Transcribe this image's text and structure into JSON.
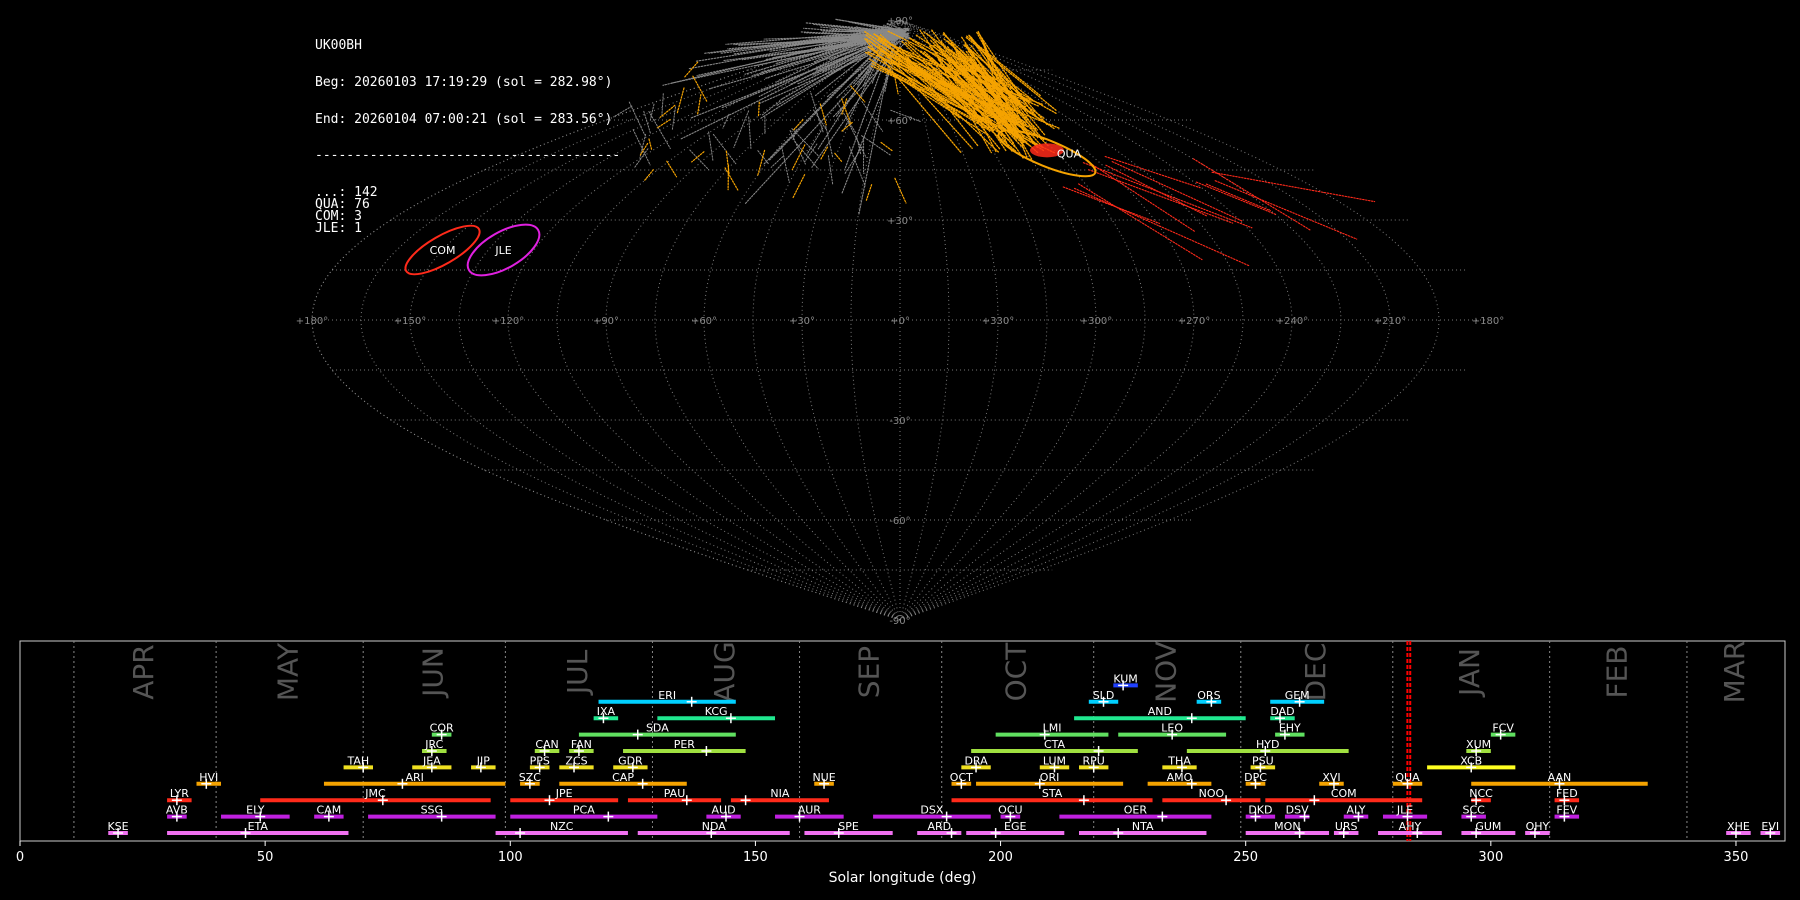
{
  "info": {
    "station": "UK00BH",
    "begin": "Beg: 20260103 17:19:29 (sol = 282.98°)",
    "end": "End: 20260104 07:00:21 (sol = 283.56°)",
    "separator": "---------------------------------------",
    "counts": [
      {
        "code": "...",
        "n": 142
      },
      {
        "code": "QUA",
        "n": 76
      },
      {
        "code": "COM",
        "n": 3
      },
      {
        "code": "JLE",
        "n": 1
      }
    ]
  },
  "colors": {
    "background": "#000000",
    "sporadic": "#888888",
    "QUA": "#f5a300",
    "COM": "#ff2a1a",
    "JLE": "#e020e0",
    "grid": "#888888",
    "current_sol": "#ff0000"
  },
  "chart_data": [
    {
      "type": "scatter",
      "projection": "sinusoidal",
      "x_ticks": [
        "+180°",
        "+150°",
        "+120°",
        "+90°",
        "+60°",
        "+30°",
        "+0°",
        "+330°",
        "+300°",
        "+270°",
        "+240°",
        "+210°",
        "+180°"
      ],
      "y_ticks": [
        "+90°",
        "+60°",
        "+30°",
        "+0°",
        "-30°",
        "-60°",
        "-90°"
      ],
      "grid": true,
      "radiants": [
        {
          "name": "QUA",
          "lon": 290,
          "lat": 50,
          "color": "#f5a300"
        },
        {
          "name": "COM",
          "lon": 150,
          "lat": 21,
          "color": "#ff2a1a"
        },
        {
          "name": "JLE",
          "lon": 130,
          "lat": 21,
          "color": "#e020e0"
        }
      ]
    },
    {
      "type": "bar",
      "xlabel": "Solar longitude (deg)",
      "xlim": [
        0,
        360
      ],
      "x_ticks": [
        0,
        50,
        100,
        150,
        200,
        250,
        300,
        350
      ],
      "current_sol": [
        282.98,
        283.56
      ],
      "months": [
        {
          "name": "APR",
          "start": 11
        },
        {
          "name": "MAY",
          "start": 40
        },
        {
          "name": "JUN",
          "start": 70
        },
        {
          "name": "JUL",
          "start": 99
        },
        {
          "name": "AUG",
          "start": 129
        },
        {
          "name": "SEP",
          "start": 159
        },
        {
          "name": "OCT",
          "start": 188
        },
        {
          "name": "NOV",
          "start": 219
        },
        {
          "name": "DEC",
          "start": 249
        },
        {
          "name": "JAN",
          "start": 280
        },
        {
          "name": "FEB",
          "start": 312
        },
        {
          "name": "MAR",
          "start": 340
        }
      ],
      "showers": [
        {
          "code": "KUM",
          "start": 223,
          "end": 228,
          "peak": 225,
          "row": 9,
          "color": "#2040ff"
        },
        {
          "code": "ERI",
          "start": 118,
          "end": 146,
          "peak": 137,
          "row": 8,
          "color": "#00d0ff"
        },
        {
          "code": "SLD",
          "start": 218,
          "end": 224,
          "peak": 221,
          "row": 8,
          "color": "#00d0ff"
        },
        {
          "code": "ORS",
          "start": 240,
          "end": 245,
          "peak": 243,
          "row": 8,
          "color": "#00d0ff"
        },
        {
          "code": "GEM",
          "start": 255,
          "end": 266,
          "peak": 261,
          "row": 8,
          "color": "#00d0ff"
        },
        {
          "code": "IXA",
          "start": 117,
          "end": 122,
          "peak": 119,
          "row": 7,
          "color": "#20e890"
        },
        {
          "code": "KCG",
          "start": 130,
          "end": 154,
          "peak": 145,
          "row": 7,
          "color": "#20e890"
        },
        {
          "code": "AND",
          "start": 215,
          "end": 250,
          "peak": 239,
          "row": 7,
          "color": "#20e890"
        },
        {
          "code": "DAD",
          "start": 255,
          "end": 260,
          "peak": 257,
          "row": 7,
          "color": "#20e890"
        },
        {
          "code": "COR",
          "start": 84,
          "end": 88,
          "peak": 86,
          "row": 6,
          "color": "#60e060"
        },
        {
          "code": "SDA",
          "start": 114,
          "end": 146,
          "peak": 126,
          "row": 6,
          "color": "#60e060"
        },
        {
          "code": "LMI",
          "start": 199,
          "end": 222,
          "peak": 209,
          "row": 6,
          "color": "#60e060"
        },
        {
          "code": "LEO",
          "start": 224,
          "end": 246,
          "peak": 235,
          "row": 6,
          "color": "#60e060"
        },
        {
          "code": "EHY",
          "start": 256,
          "end": 262,
          "peak": 258,
          "row": 6,
          "color": "#60e060"
        },
        {
          "code": "FCV",
          "start": 300,
          "end": 305,
          "peak": 302,
          "row": 6,
          "color": "#60e060"
        },
        {
          "code": "JRC",
          "start": 82,
          "end": 87,
          "peak": 84,
          "row": 5,
          "color": "#a0e040"
        },
        {
          "code": "CAN",
          "start": 105,
          "end": 110,
          "peak": 107,
          "row": 5,
          "color": "#a0e040"
        },
        {
          "code": "FAN",
          "start": 112,
          "end": 117,
          "peak": 114,
          "row": 5,
          "color": "#a0e040"
        },
        {
          "code": "PER",
          "start": 123,
          "end": 148,
          "peak": 140,
          "row": 5,
          "color": "#a0e040"
        },
        {
          "code": "CTA",
          "start": 194,
          "end": 228,
          "peak": 220,
          "row": 5,
          "color": "#a0e040"
        },
        {
          "code": "HYD",
          "start": 238,
          "end": 271,
          "peak": 254,
          "row": 5,
          "color": "#a0e040"
        },
        {
          "code": "XUM",
          "start": 295,
          "end": 300,
          "peak": 297,
          "row": 5,
          "color": "#a0e040"
        },
        {
          "code": "TAH",
          "start": 66,
          "end": 72,
          "peak": 70,
          "row": 4,
          "color": "#f0e020"
        },
        {
          "code": "JEA",
          "start": 80,
          "end": 88,
          "peak": 84,
          "row": 4,
          "color": "#f0e020"
        },
        {
          "code": "JIP",
          "start": 92,
          "end": 97,
          "peak": 94,
          "row": 4,
          "color": "#f0e020"
        },
        {
          "code": "PPS",
          "start": 104,
          "end": 108,
          "peak": 106,
          "row": 4,
          "color": "#f0e020"
        },
        {
          "code": "ZCS",
          "start": 110,
          "end": 117,
          "peak": 113,
          "row": 4,
          "color": "#f0e020"
        },
        {
          "code": "GDR",
          "start": 121,
          "end": 128,
          "peak": 125,
          "row": 4,
          "color": "#f0e020"
        },
        {
          "code": "DRA",
          "start": 192,
          "end": 198,
          "peak": 195,
          "row": 4,
          "color": "#f0e020"
        },
        {
          "code": "LUM",
          "start": 208,
          "end": 214,
          "peak": 211,
          "row": 4,
          "color": "#f0e020"
        },
        {
          "code": "RPU",
          "start": 216,
          "end": 222,
          "peak": 219,
          "row": 4,
          "color": "#f0e020"
        },
        {
          "code": "THA",
          "start": 233,
          "end": 240,
          "peak": 237,
          "row": 4,
          "color": "#f0e020"
        },
        {
          "code": "PSU",
          "start": 251,
          "end": 256,
          "peak": 253,
          "row": 4,
          "color": "#f0e020"
        },
        {
          "code": "XCB",
          "start": 287,
          "end": 305,
          "peak": 296,
          "row": 4,
          "color": "#ffff20"
        },
        {
          "code": "HVI",
          "start": 36,
          "end": 41,
          "peak": 38,
          "row": 3,
          "color": "#f5a300"
        },
        {
          "code": "ARI",
          "start": 62,
          "end": 99,
          "peak": 78,
          "row": 3,
          "color": "#f5a300"
        },
        {
          "code": "SZC",
          "start": 102,
          "end": 106,
          "peak": 104,
          "row": 3,
          "color": "#f5a300"
        },
        {
          "code": "CAP",
          "start": 110,
          "end": 136,
          "peak": 127,
          "row": 3,
          "color": "#f5a300"
        },
        {
          "code": "NUE",
          "start": 162,
          "end": 166,
          "peak": 164,
          "row": 3,
          "color": "#f5a300"
        },
        {
          "code": "OCT",
          "start": 190,
          "end": 194,
          "peak": 192,
          "row": 3,
          "color": "#f5a300"
        },
        {
          "code": "ORI",
          "start": 195,
          "end": 225,
          "peak": 208,
          "row": 3,
          "color": "#f5a300"
        },
        {
          "code": "AMO",
          "start": 230,
          "end": 243,
          "peak": 239,
          "row": 3,
          "color": "#f5a300"
        },
        {
          "code": "DPC",
          "start": 250,
          "end": 254,
          "peak": 252,
          "row": 3,
          "color": "#f5a300"
        },
        {
          "code": "XVI",
          "start": 265,
          "end": 270,
          "peak": 268,
          "row": 3,
          "color": "#f5a300"
        },
        {
          "code": "QUA",
          "start": 280,
          "end": 286,
          "peak": 283,
          "row": 3,
          "color": "#f5a300"
        },
        {
          "code": "AAN",
          "start": 296,
          "end": 332,
          "peak": 314,
          "row": 3,
          "color": "#f5a300"
        },
        {
          "code": "LYR",
          "start": 30,
          "end": 35,
          "peak": 32,
          "row": 2,
          "color": "#ff2a1a"
        },
        {
          "code": "JMC",
          "start": 49,
          "end": 96,
          "peak": 74,
          "row": 2,
          "color": "#ff2a1a"
        },
        {
          "code": "JPE",
          "start": 100,
          "end": 122,
          "peak": 108,
          "row": 2,
          "color": "#ff2a1a"
        },
        {
          "code": "PAU",
          "start": 124,
          "end": 143,
          "peak": 136,
          "row": 2,
          "color": "#ff2a1a"
        },
        {
          "code": "NIA",
          "start": 145,
          "end": 165,
          "peak": 148,
          "row": 2,
          "color": "#ff2a1a"
        },
        {
          "code": "STA",
          "start": 190,
          "end": 231,
          "peak": 217,
          "row": 2,
          "color": "#ff2a1a"
        },
        {
          "code": "NOO",
          "start": 233,
          "end": 253,
          "peak": 246,
          "row": 2,
          "color": "#ff2a1a"
        },
        {
          "code": "COM",
          "start": 254,
          "end": 286,
          "peak": 264,
          "row": 2,
          "color": "#ff2a1a"
        },
        {
          "code": "NCC",
          "start": 296,
          "end": 300,
          "peak": 297,
          "row": 2,
          "color": "#ff2a1a"
        },
        {
          "code": "FED",
          "start": 313,
          "end": 318,
          "peak": 315,
          "row": 2,
          "color": "#ff2a1a"
        },
        {
          "code": "AVB",
          "start": 30,
          "end": 34,
          "peak": 32,
          "row": 1,
          "color": "#c020e0"
        },
        {
          "code": "ELY",
          "start": 41,
          "end": 55,
          "peak": 49,
          "row": 1,
          "color": "#c020e0"
        },
        {
          "code": "CAM",
          "start": 60,
          "end": 66,
          "peak": 63,
          "row": 1,
          "color": "#c020e0"
        },
        {
          "code": "SSG",
          "start": 71,
          "end": 97,
          "peak": 86,
          "row": 1,
          "color": "#c020e0"
        },
        {
          "code": "PCA",
          "start": 100,
          "end": 130,
          "peak": 120,
          "row": 1,
          "color": "#c020e0"
        },
        {
          "code": "AUD",
          "start": 140,
          "end": 147,
          "peak": 144,
          "row": 1,
          "color": "#c020e0"
        },
        {
          "code": "AUR",
          "start": 154,
          "end": 168,
          "peak": 159,
          "row": 1,
          "color": "#c020e0"
        },
        {
          "code": "DSX",
          "start": 174,
          "end": 198,
          "peak": 189,
          "row": 1,
          "color": "#c020e0"
        },
        {
          "code": "OCU",
          "start": 200,
          "end": 204,
          "peak": 202,
          "row": 1,
          "color": "#c020e0"
        },
        {
          "code": "OER",
          "start": 212,
          "end": 243,
          "peak": 233,
          "row": 1,
          "color": "#c020e0"
        },
        {
          "code": "DKD",
          "start": 250,
          "end": 256,
          "peak": 252,
          "row": 1,
          "color": "#c020e0"
        },
        {
          "code": "DSV",
          "start": 258,
          "end": 263,
          "peak": 262,
          "row": 1,
          "color": "#c020e0"
        },
        {
          "code": "ALY",
          "start": 270,
          "end": 275,
          "peak": 273,
          "row": 1,
          "color": "#c020e0"
        },
        {
          "code": "JLE",
          "start": 278,
          "end": 287,
          "peak": 283,
          "row": 1,
          "color": "#c020e0"
        },
        {
          "code": "SCC",
          "start": 294,
          "end": 299,
          "peak": 296,
          "row": 1,
          "color": "#c020e0"
        },
        {
          "code": "FEV",
          "start": 313,
          "end": 318,
          "peak": 315,
          "row": 1,
          "color": "#c020e0"
        },
        {
          "code": "KSE",
          "start": 18,
          "end": 22,
          "peak": 20,
          "row": 0,
          "color": "#f070f0"
        },
        {
          "code": "ETA",
          "start": 30,
          "end": 67,
          "peak": 46,
          "row": 0,
          "color": "#f070f0"
        },
        {
          "code": "NZC",
          "start": 97,
          "end": 124,
          "peak": 102,
          "row": 0,
          "color": "#f070f0"
        },
        {
          "code": "NDA",
          "start": 126,
          "end": 157,
          "peak": 141,
          "row": 0,
          "color": "#f070f0"
        },
        {
          "code": "SPE",
          "start": 160,
          "end": 178,
          "peak": 167,
          "row": 0,
          "color": "#f070f0"
        },
        {
          "code": "ARD",
          "start": 183,
          "end": 192,
          "peak": 190,
          "row": 0,
          "color": "#f070f0"
        },
        {
          "code": "EGE",
          "start": 193,
          "end": 213,
          "peak": 199,
          "row": 0,
          "color": "#f070f0"
        },
        {
          "code": "NTA",
          "start": 216,
          "end": 242,
          "peak": 224,
          "row": 0,
          "color": "#f070f0"
        },
        {
          "code": "MON",
          "start": 250,
          "end": 267,
          "peak": 261,
          "row": 0,
          "color": "#f070f0"
        },
        {
          "code": "URS",
          "start": 268,
          "end": 273,
          "peak": 270,
          "row": 0,
          "color": "#f070f0"
        },
        {
          "code": "AHY",
          "start": 277,
          "end": 290,
          "peak": 285,
          "row": 0,
          "color": "#f070f0"
        },
        {
          "code": "GUM",
          "start": 294,
          "end": 305,
          "peak": 297,
          "row": 0,
          "color": "#f070f0"
        },
        {
          "code": "OHY",
          "start": 307,
          "end": 312,
          "peak": 309,
          "row": 0,
          "color": "#f070f0"
        },
        {
          "code": "XHE",
          "start": 348,
          "end": 353,
          "peak": 350,
          "row": 0,
          "color": "#f070f0"
        },
        {
          "code": "EVI",
          "start": 355,
          "end": 359,
          "peak": 357,
          "row": 0,
          "color": "#f070f0"
        }
      ]
    }
  ]
}
